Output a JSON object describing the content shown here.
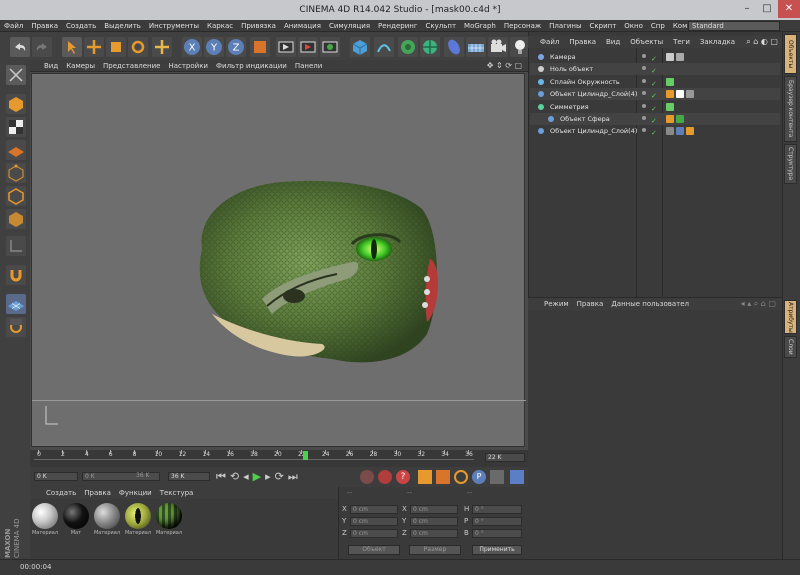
{
  "window": {
    "title": "CINEMA 4D R14.042 Studio - [mask00.c4d *]"
  },
  "menubar": {
    "items": [
      "Файл",
      "Правка",
      "Создать",
      "Выделить",
      "Инструменты",
      "Каркас",
      "Привязка",
      "Анимация",
      "Симуляция",
      "Рендеринг",
      "Скульпт",
      "MoGraph",
      "Персонаж",
      "Плагины",
      "Скрипт",
      "Окно",
      "Спр",
      "Компоновка"
    ],
    "layout_value": "Standard"
  },
  "viewport": {
    "menu": [
      "Вид",
      "Камеры",
      "Представление",
      "Настройки",
      "Фильтр индикации",
      "Панели"
    ]
  },
  "object_manager": {
    "menu": [
      "Файл",
      "Правка",
      "Вид",
      "Объекты",
      "Теги",
      "Закладка"
    ],
    "objects": [
      {
        "name": "Камера",
        "indent": 0
      },
      {
        "name": "Ноль объект",
        "indent": 0
      },
      {
        "name": "Сплайн Окружность",
        "indent": 0
      },
      {
        "name": "Объект Цилиндр_Слой(4)",
        "indent": 0
      },
      {
        "name": "Симметрия",
        "indent": 0
      },
      {
        "name": "Объект Сфера",
        "indent": 1
      },
      {
        "name": "Объект Цилиндр_Слой(4)",
        "indent": 0
      }
    ]
  },
  "attribute_manager": {
    "menu": [
      "Режим",
      "Правка",
      "Данные пользовател"
    ]
  },
  "right_tabs": [
    "Объекты",
    "Браузер контента",
    "Структура",
    "Атрибуты",
    "Слои"
  ],
  "timeline": {
    "ticks": [
      "0",
      "2",
      "4",
      "6",
      "8",
      "10",
      "12",
      "14",
      "16",
      "18",
      "20",
      "22",
      "24",
      "26",
      "28",
      "30",
      "32",
      "34",
      "36"
    ],
    "current_frame": "22",
    "end_field": "22 K"
  },
  "transport": {
    "start": "0 K",
    "range_start": "0 K",
    "range_end": "36 K",
    "end": "36 K"
  },
  "material_manager": {
    "menu": [
      "Создать",
      "Правка",
      "Функции",
      "Текстура"
    ],
    "materials": [
      {
        "label": "Материал",
        "color": "#c9c9c9"
      },
      {
        "label": "Мат",
        "color": "#111111"
      },
      {
        "label": "Материал",
        "color": "#8a8a8a"
      },
      {
        "label": "Материал",
        "color": "#9aa43a"
      },
      {
        "label": "Материал",
        "color": "#3f6a2a"
      }
    ]
  },
  "coordinates": {
    "header": [
      "--",
      "--",
      "--"
    ],
    "rows": [
      {
        "axis": "X",
        "pos": "0 cm",
        "size": "0 cm",
        "rot_label": "H",
        "rot": "0 °"
      },
      {
        "axis": "Y",
        "pos": "0 cm",
        "size": "0 cm",
        "rot_label": "P",
        "rot": "0 °"
      },
      {
        "axis": "Z",
        "pos": "0 cm",
        "size": "0 cm",
        "rot_label": "B",
        "rot": "0 °"
      }
    ],
    "mode_select": "Объект",
    "size_select": "Размер",
    "apply_label": "Применить"
  },
  "brand": {
    "line1": "MAXON",
    "line2": "CINEMA 4D"
  },
  "status": {
    "time": "00:00:04"
  }
}
